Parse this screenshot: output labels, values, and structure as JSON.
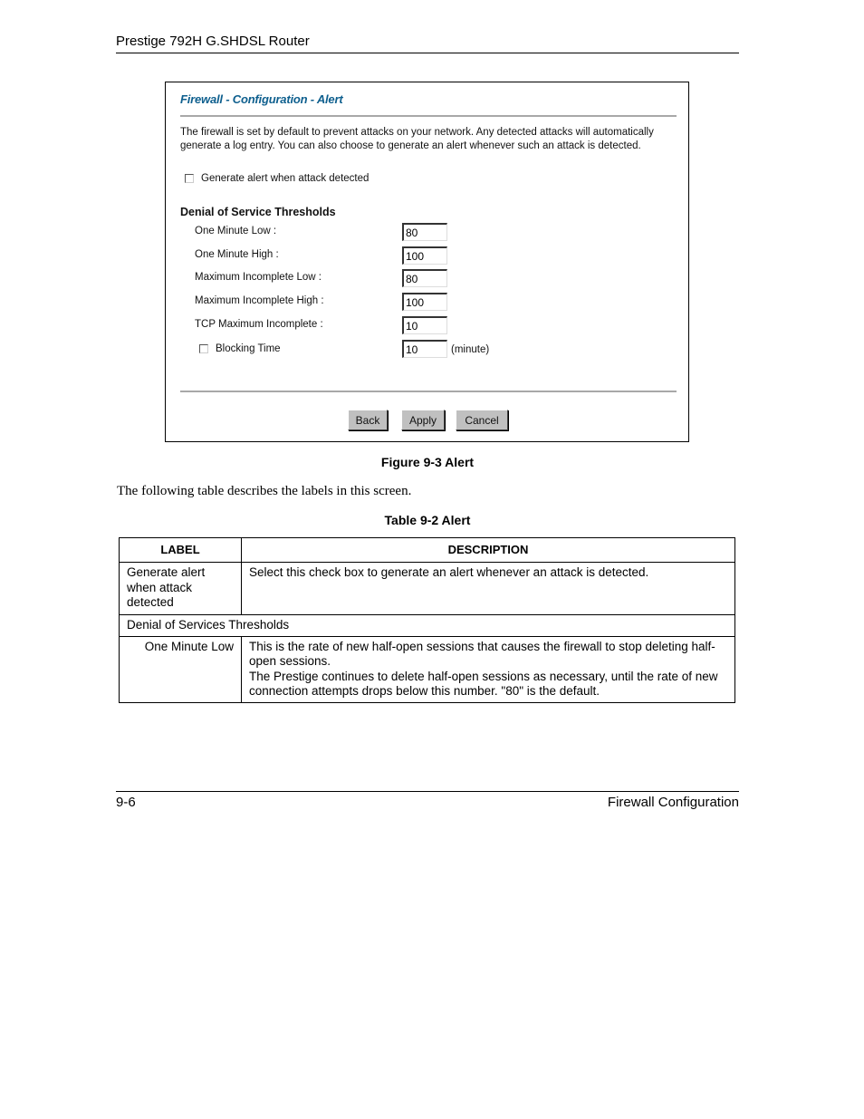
{
  "header": {
    "title": "Prestige 792H G.SHDSL Router"
  },
  "screen": {
    "title": "Firewall - Configuration - Alert",
    "intro": "The firewall is set by default to prevent attacks on your network. Any detected attacks will automatically generate a log entry. You can also choose to generate an alert whenever such an attack is detected.",
    "generate_alert": {
      "label": "Generate alert when attack detected",
      "checked": false
    },
    "section_title": "Denial of Service Thresholds",
    "fields": [
      {
        "label": "One Minute Low :",
        "value": "80"
      },
      {
        "label": "One Minute High :",
        "value": "100"
      },
      {
        "label": "Maximum Incomplete Low :",
        "value": "80"
      },
      {
        "label": "Maximum Incomplete High :",
        "value": "100"
      },
      {
        "label": "TCP Maximum Incomplete :",
        "value": "10"
      }
    ],
    "blocking_time": {
      "label": "Blocking Time",
      "checked": false,
      "value": "10",
      "unit": "(minute)"
    },
    "buttons": {
      "back": "Back",
      "apply": "Apply",
      "cancel": "Cancel"
    },
    "title_color": "#0e5f8e"
  },
  "figure_caption": "Figure 9-3 Alert",
  "body_text": "The following table describes the labels in this screen.",
  "table_caption": "Table 9-2 Alert",
  "table": {
    "headers": [
      "LABEL",
      "DESCRIPTION"
    ],
    "rows": [
      {
        "label": "Generate alert when attack detected",
        "description": "Select this check box to generate an alert whenever an attack is detected."
      },
      {
        "section": "Denial of Services Thresholds"
      },
      {
        "label": "One Minute Low",
        "description_lines": [
          "This is the rate of new half-open sessions that causes the firewall to stop deleting half-open sessions.",
          "The Prestige continues to delete half-open sessions as necessary, until the rate of new connection attempts drops below this number. \"80\" is the default."
        ]
      }
    ]
  },
  "footer": {
    "page_number": "9-6",
    "chapter": "Firewall Configuration"
  }
}
